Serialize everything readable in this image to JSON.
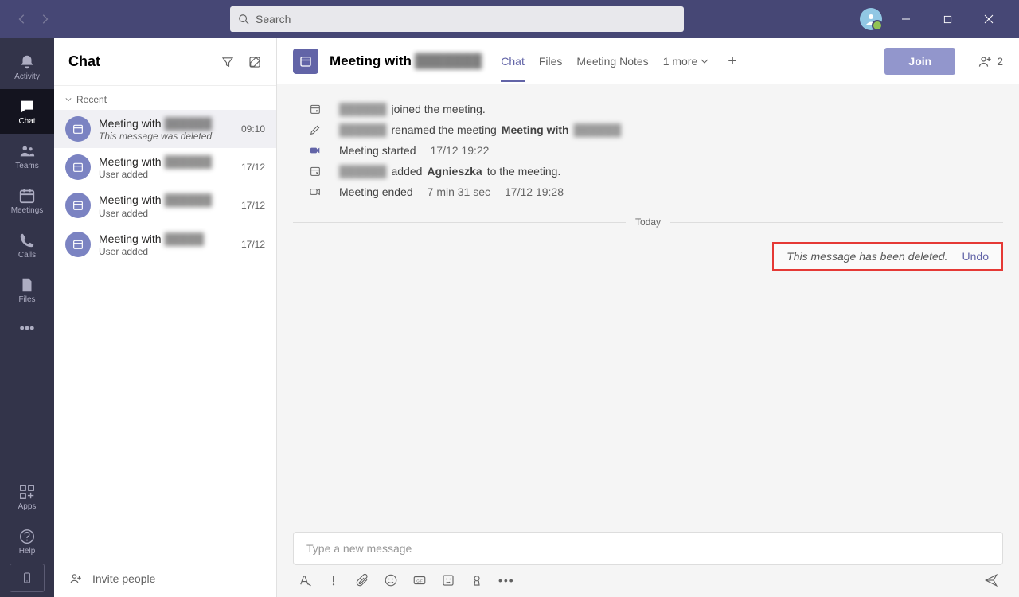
{
  "titlebar": {
    "search_placeholder": "Search"
  },
  "rail": {
    "items": [
      {
        "label": "Activity"
      },
      {
        "label": "Chat"
      },
      {
        "label": "Teams"
      },
      {
        "label": "Meetings"
      },
      {
        "label": "Calls"
      },
      {
        "label": "Files"
      }
    ],
    "apps": "Apps",
    "help": "Help"
  },
  "sidebar": {
    "title": "Chat",
    "section": "Recent",
    "invite": "Invite people",
    "conversations": [
      {
        "title_prefix": "Meeting with",
        "title_blur": "██████",
        "sub": "This message was deleted",
        "time": "09:10",
        "italic": true
      },
      {
        "title_prefix": "Meeting with",
        "title_blur": "██████",
        "sub": "User added",
        "time": "17/12",
        "italic": false
      },
      {
        "title_prefix": "Meeting with",
        "title_blur": "██████",
        "sub": "User added",
        "time": "17/12",
        "italic": false
      },
      {
        "title_prefix": "Meeting with",
        "title_blur": "█████",
        "sub": "User added",
        "time": "17/12",
        "italic": false
      }
    ]
  },
  "header": {
    "title_prefix": "Meeting with",
    "title_blur": "███████",
    "tabs": [
      "Chat",
      "Files",
      "Meeting Notes"
    ],
    "more": "1 more",
    "join": "Join",
    "participants": "2"
  },
  "timeline": {
    "rows": [
      {
        "icon": "join",
        "blur": "██████",
        "text": "joined the meeting."
      },
      {
        "icon": "pencil",
        "blur": "██████",
        "text": "renamed the meeting",
        "strong": "Meeting with",
        "blur2": "██████"
      },
      {
        "icon": "video",
        "text": "Meeting started",
        "meta": "17/12 19:22"
      },
      {
        "icon": "join",
        "blur": "██████",
        "text": "added",
        "strong": "Agnieszka",
        "text2": "to the meeting."
      },
      {
        "icon": "videoend",
        "text": "Meeting ended",
        "meta": "7 min 31 sec",
        "meta2": "17/12 19:28"
      }
    ],
    "divider": "Today",
    "deleted": {
      "msg": "This message has been deleted.",
      "undo": "Undo"
    }
  },
  "compose": {
    "placeholder": "Type a new message"
  }
}
